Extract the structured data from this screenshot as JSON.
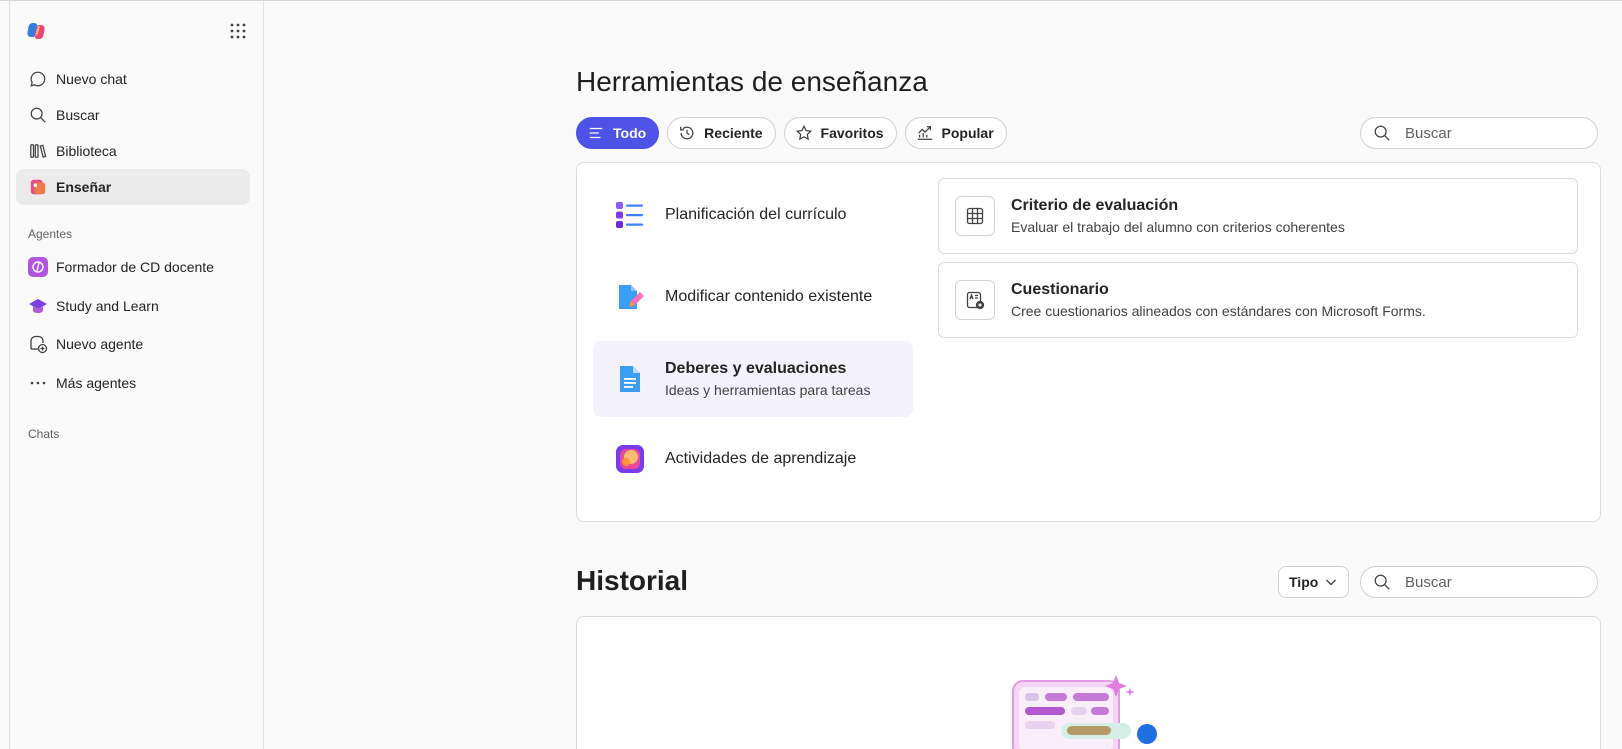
{
  "sidebar": {
    "nav": [
      {
        "label": "Nuevo chat",
        "icon": "chat-icon"
      },
      {
        "label": "Buscar",
        "icon": "search-icon"
      },
      {
        "label": "Biblioteca",
        "icon": "library-icon"
      },
      {
        "label": "Enseñar",
        "icon": "teach-icon",
        "active": true
      }
    ],
    "agents_label": "Agentes",
    "agents": [
      {
        "label": "Formador de CD docente",
        "icon": "trainer-agent-icon"
      },
      {
        "label": "Study and Learn",
        "icon": "graduation-cap-icon"
      },
      {
        "label": "Nuevo agente",
        "icon": "new-agent-icon"
      },
      {
        "label": "Más agentes",
        "icon": "more-icon"
      }
    ],
    "chats_label": "Chats"
  },
  "main": {
    "title": "Herramientas de enseñanza",
    "filters": [
      {
        "label": "Todo",
        "icon": "list-icon",
        "selected": true
      },
      {
        "label": "Reciente",
        "icon": "history-icon"
      },
      {
        "label": "Favoritos",
        "icon": "star-icon"
      },
      {
        "label": "Popular",
        "icon": "trending-icon"
      }
    ],
    "search_placeholder": "Buscar",
    "categories": [
      {
        "title": "Planificación del currículo",
        "icon": "curriculum-list-icon"
      },
      {
        "title": "Modificar contenido existente",
        "icon": "edit-document-icon"
      },
      {
        "title": "Deberes y evaluaciones",
        "desc": "Ideas y herramientas para tareas",
        "icon": "assignment-document-icon",
        "active": true
      },
      {
        "title": "Actividades de aprendizaje",
        "icon": "learning-activities-icon"
      }
    ],
    "tools": [
      {
        "title": "Criterio de evaluación",
        "desc": "Evaluar el trabajo del alumno con criterios coherentes",
        "icon": "rubric-table-icon"
      },
      {
        "title": "Cuestionario",
        "desc": "Cree cuestionarios alineados con estándares con Microsoft Forms.",
        "icon": "quiz-icon"
      }
    ],
    "history_title": "Historial",
    "type_filter": "Tipo",
    "history_search_placeholder": "Buscar"
  },
  "colors": {
    "accent": "#4f52e6",
    "active_category_bg": "#f3f2fd",
    "active_nav_bg": "#ebebeb"
  }
}
